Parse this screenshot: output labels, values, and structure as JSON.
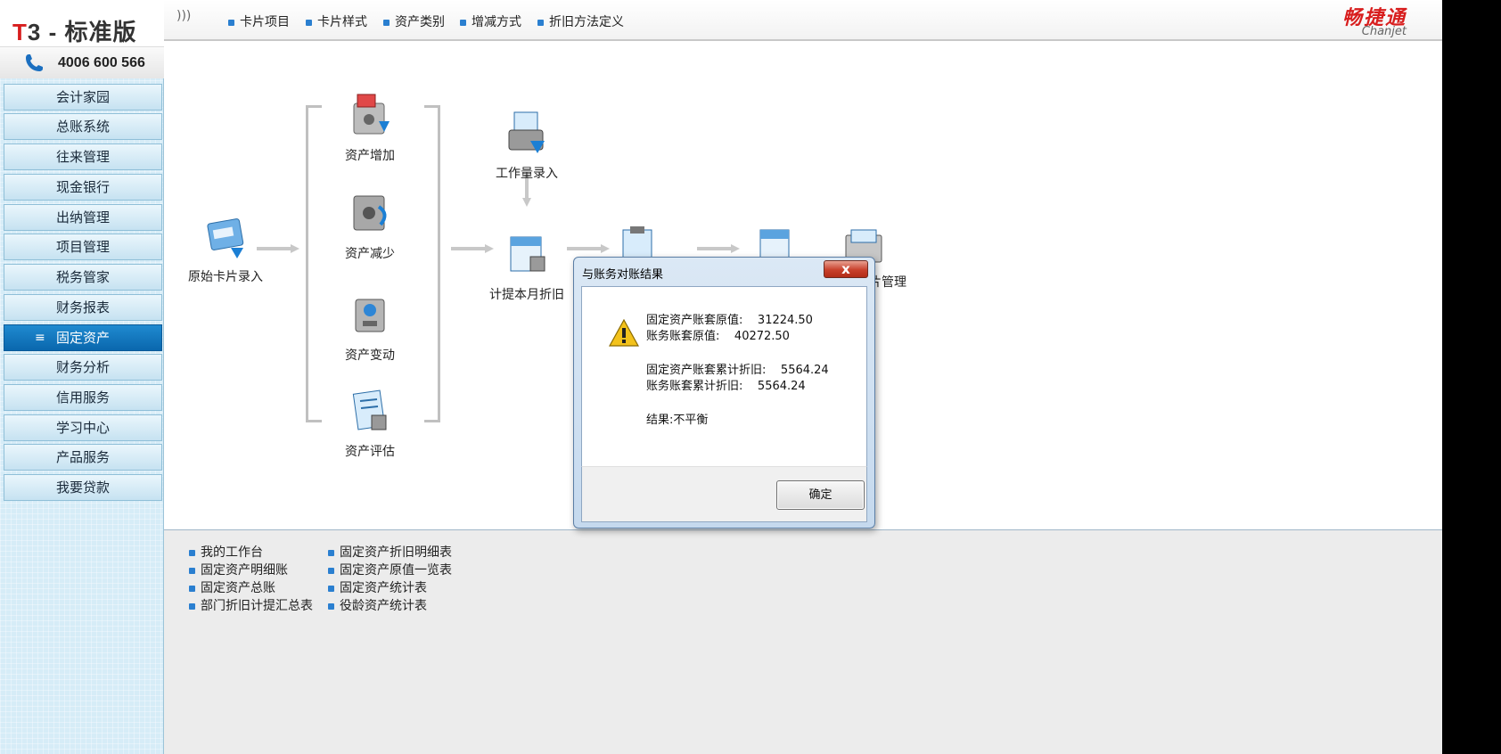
{
  "brand": {
    "t": "T",
    "rest": "3 - 标准版",
    "phone": "4006 600 566"
  },
  "logo": {
    "cn": "畅捷通",
    "en": "Chanjet"
  },
  "sidebar": {
    "items": [
      {
        "label": "会计家园"
      },
      {
        "label": "总账系统"
      },
      {
        "label": "往来管理"
      },
      {
        "label": "现金银行"
      },
      {
        "label": "出纳管理"
      },
      {
        "label": "项目管理"
      },
      {
        "label": "税务管家"
      },
      {
        "label": "财务报表"
      },
      {
        "label": "固定资产",
        "active": true
      },
      {
        "label": "财务分析"
      },
      {
        "label": "信用服务"
      },
      {
        "label": "学习中心"
      },
      {
        "label": "产品服务"
      },
      {
        "label": "我要贷款"
      }
    ]
  },
  "topbar": {
    "collapse": ")))",
    "menu": [
      "卡片项目",
      "卡片样式",
      "资产类别",
      "增减方式",
      "折旧方法定义"
    ]
  },
  "flow": {
    "original_card": "原始卡片录入",
    "asset_add": "资产增加",
    "asset_reduce": "资产减少",
    "asset_change": "资产变动",
    "asset_eval": "资产评估",
    "workload": "工作量录入",
    "depreciation": "计提本月折旧",
    "card_mgmt": "片管理"
  },
  "bottom_links": {
    "col1": [
      "我的工作台",
      "固定资产明细账",
      "固定资产总账",
      "部门折旧计提汇总表"
    ],
    "col2": [
      "固定资产折旧明细表",
      "固定资产原值一览表",
      "固定资产统计表",
      "役龄资产统计表"
    ]
  },
  "dialog": {
    "title": "与账务对账结果",
    "close": "x",
    "line1_label": "固定资产账套原值:",
    "line1_value": "31224.50",
    "line2_label": "账务账套原值:",
    "line2_value": "40272.50",
    "line3_label": "固定资产账套累计折旧:",
    "line3_value": "5564.24",
    "line4_label": "账务账套累计折旧:",
    "line4_value": "5564.24",
    "result": "结果:不平衡",
    "ok": "确定"
  }
}
